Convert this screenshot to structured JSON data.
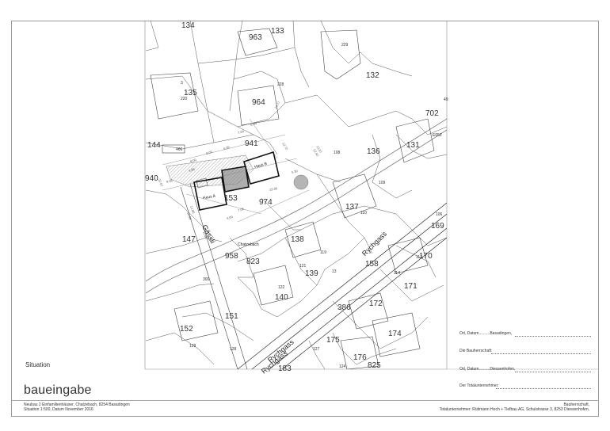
{
  "sheet": {
    "section_label": "Situation",
    "title": "baueingabe",
    "project_lines": [
      "Neubau 2 Einfamilienhäuser, Chatzebach, 8254 Basadingen",
      "Situation 1:500, Datum November 2016"
    ]
  },
  "signatures": [
    {
      "label": "Ort, Datum..........Basadingen,"
    },
    {
      "label": "Die Bauherrschaft:"
    },
    {
      "label": "Ort, Datum..........Diessenhofen,"
    },
    {
      "label": "Der Totalunternehmer:"
    }
  ],
  "footer": {
    "line1": "Bauherrschaft,",
    "line2": "Totalunternehmer: Rütimann Hoch + Tiefbau AG, Schulstrasse 3, 8253 Diessenhofen,"
  },
  "map": {
    "parcels": [
      {
        "id": "134",
        "size": "large"
      },
      {
        "id": "963",
        "size": "large"
      },
      {
        "id": "133",
        "size": "large"
      },
      {
        "id": "229",
        "size": "small"
      },
      {
        "id": "132",
        "size": "large"
      },
      {
        "id": "135",
        "size": "large"
      },
      {
        "id": "3",
        "size": "small"
      },
      {
        "id": "228",
        "size": "small"
      },
      {
        "id": "220",
        "size": "small"
      },
      {
        "id": "964",
        "size": "large"
      },
      {
        "id": "702",
        "size": "large"
      },
      {
        "id": "49",
        "size": "small"
      },
      {
        "id": "144",
        "size": "large"
      },
      {
        "id": "466",
        "size": "small"
      },
      {
        "id": "941",
        "size": "large"
      },
      {
        "id": "136",
        "size": "large"
      },
      {
        "id": "131",
        "size": "large"
      },
      {
        "id": "E052",
        "size": "small"
      },
      {
        "id": "108",
        "size": "small"
      },
      {
        "id": "940",
        "size": "large"
      },
      {
        "id": "153",
        "size": "large"
      },
      {
        "id": "974",
        "size": "large"
      },
      {
        "id": "137",
        "size": "large"
      },
      {
        "id": "110",
        "size": "small"
      },
      {
        "id": "109",
        "size": "small"
      },
      {
        "id": "106",
        "size": "small"
      },
      {
        "id": "169",
        "size": "large"
      },
      {
        "id": "147",
        "size": "large"
      },
      {
        "id": "138",
        "size": "large"
      },
      {
        "id": "119",
        "size": "small"
      },
      {
        "id": "958",
        "size": "large"
      },
      {
        "id": "823",
        "size": "large"
      },
      {
        "id": "121",
        "size": "small"
      },
      {
        "id": "139",
        "size": "large"
      },
      {
        "id": "158",
        "size": "large"
      },
      {
        "id": "112",
        "size": "small"
      },
      {
        "id": "170",
        "size": "large"
      },
      {
        "id": "114",
        "size": "small"
      },
      {
        "id": "171",
        "size": "large"
      },
      {
        "id": "300",
        "size": "small"
      },
      {
        "id": "122",
        "size": "small"
      },
      {
        "id": "140",
        "size": "large"
      },
      {
        "id": "386",
        "size": "large"
      },
      {
        "id": "172",
        "size": "large"
      },
      {
        "id": "151",
        "size": "large"
      },
      {
        "id": "152",
        "size": "large"
      },
      {
        "id": "129",
        "size": "small"
      },
      {
        "id": "128",
        "size": "small"
      },
      {
        "id": "174",
        "size": "large"
      },
      {
        "id": "175",
        "size": "large"
      },
      {
        "id": "127",
        "size": "small"
      },
      {
        "id": "176",
        "size": "large"
      },
      {
        "id": "825",
        "size": "large"
      },
      {
        "id": "183",
        "size": "large"
      },
      {
        "id": "124",
        "size": "small"
      },
      {
        "id": "13",
        "size": "small"
      }
    ],
    "streets": [
      "Gässli",
      "Rychgass",
      "Rychgass",
      "Rychgass"
    ],
    "stream": "Chatzebach",
    "houses": [
      "Haus A",
      "Haus B"
    ],
    "dimensions": [
      "7.00",
      "5.00",
      "8.00",
      "6.00",
      "8.00",
      "9.88",
      "12.72",
      "12.42",
      "13.57",
      "9.58",
      "5.30",
      "13.00",
      "9.00",
      "7.08",
      "11.97",
      "12.00",
      "10.50",
      "11.00",
      "14.77"
    ],
    "colors": {
      "line": "#4a4a4a",
      "building": "#111111",
      "hatch": "#8a8a8a",
      "tree": "#9c9c9c"
    }
  }
}
